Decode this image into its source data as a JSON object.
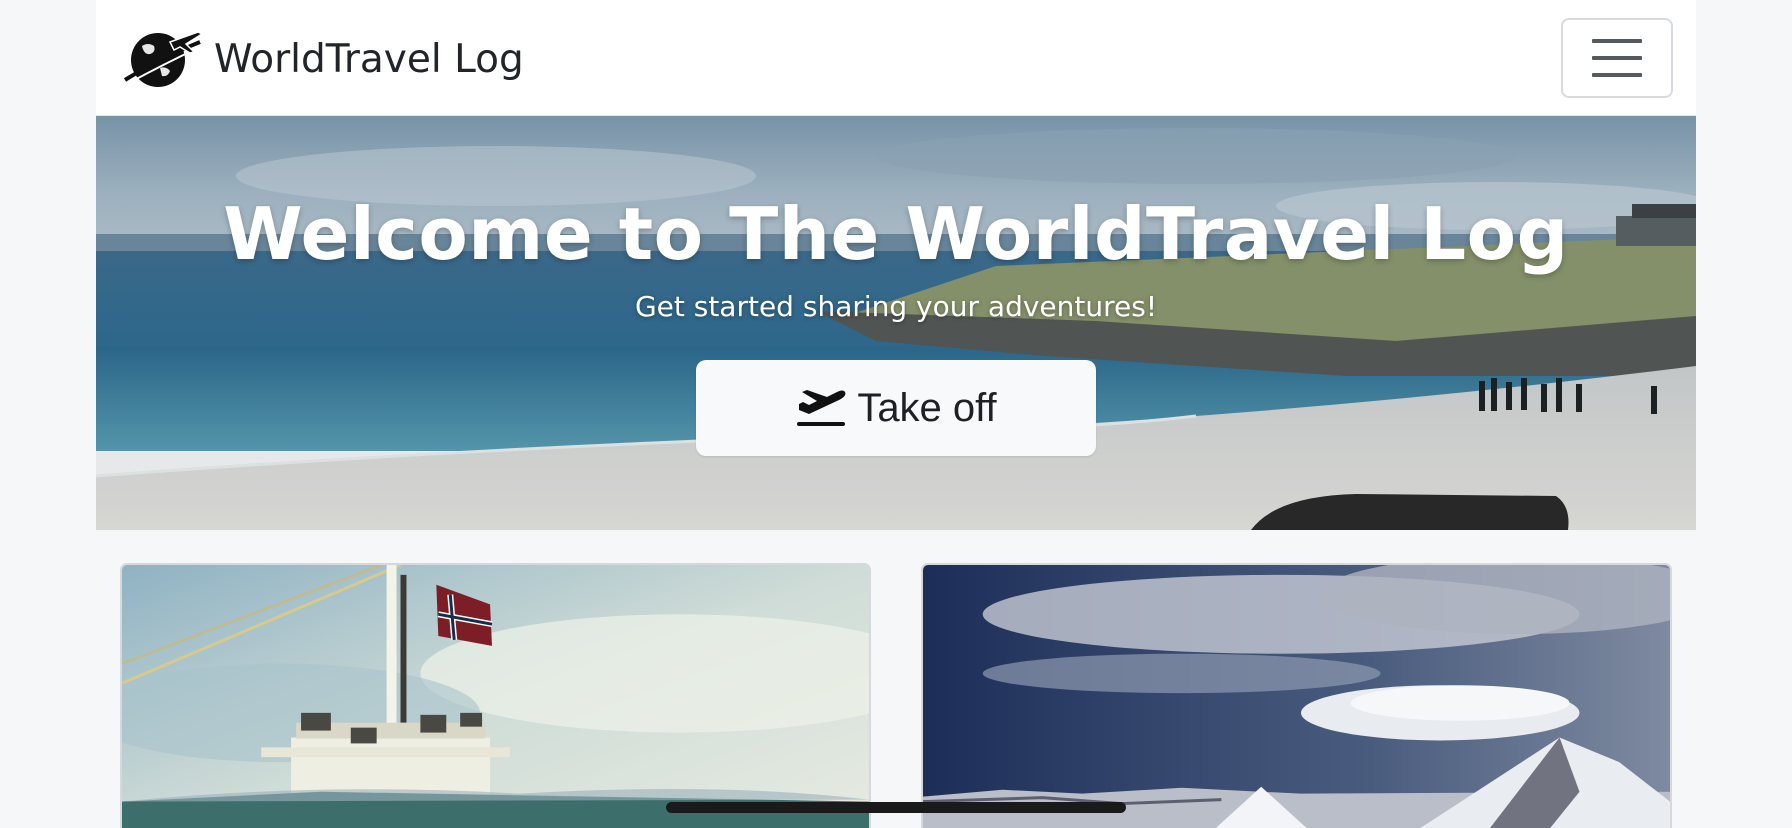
{
  "navbar": {
    "brand_name": "WorldTravel Log",
    "logo_icon": "globe-airplane-icon",
    "menu_icon": "hamburger-icon"
  },
  "hero": {
    "title": "Welcome to The WorldTravel Log",
    "subtitle": "Get started sharing your adventures!",
    "cta_label": "Take off",
    "cta_icon": "plane-departure-icon"
  },
  "cards": [
    {
      "image": "ship-mast-with-flag-photo"
    },
    {
      "image": "snowy-mountain-peaks-photo"
    }
  ],
  "colors": {
    "navbar_bg": "#ffffff",
    "page_bg": "#f5f7f9",
    "button_bg": "#f8f9fa",
    "text_dark": "#212529"
  }
}
